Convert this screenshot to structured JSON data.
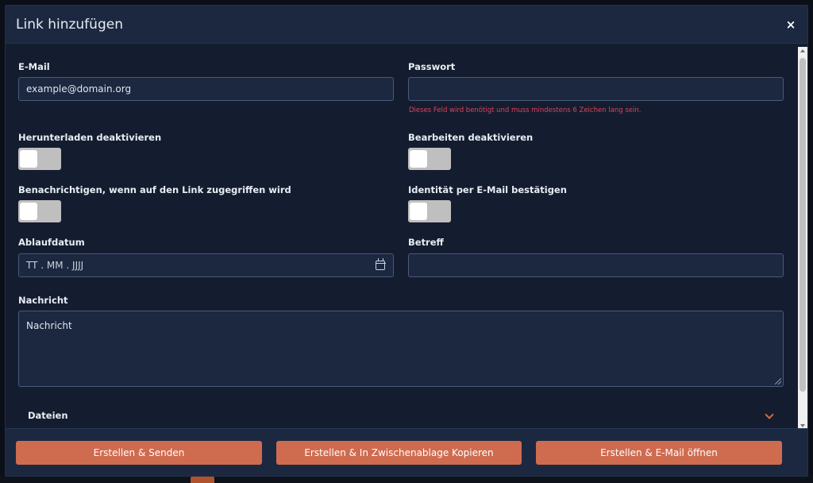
{
  "modal": {
    "title": "Link hinzufügen",
    "close_label": "×"
  },
  "form": {
    "email": {
      "label": "E-Mail",
      "value": "example@domain.org"
    },
    "password": {
      "label": "Passwort",
      "value": "",
      "error": "Dieses Feld wird benötigt und muss mindestens 6 Zeichen lang sein."
    },
    "disable_download": {
      "label": "Herunterladen deaktivieren",
      "checked": false
    },
    "disable_edit": {
      "label": "Bearbeiten deaktivieren",
      "checked": false
    },
    "notify_on_access": {
      "label": "Benachrichtigen, wenn auf den Link zugegriffen wird",
      "checked": false
    },
    "verify_identity": {
      "label": "Identität per E-Mail bestätigen",
      "checked": false
    },
    "expiry_date": {
      "label": "Ablaufdatum",
      "placeholder": "TT . MM . JJJJ"
    },
    "subject": {
      "label": "Betreff",
      "value": ""
    },
    "message": {
      "label": "Nachricht",
      "placeholder": "Nachricht"
    },
    "files": {
      "label": "Dateien"
    }
  },
  "footer": {
    "create_send": "Erstellen & Senden",
    "create_copy": "Erstellen & In Zwischenablage Kopieren",
    "create_email": "Erstellen & E-Mail öffnen"
  },
  "colors": {
    "accent": "#cf6b4f",
    "error": "#e0405e",
    "background": "#141d2f",
    "header": "#1c2840"
  }
}
